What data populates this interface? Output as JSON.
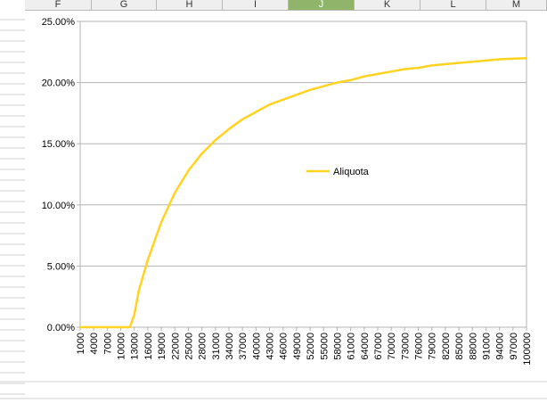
{
  "spreadsheet": {
    "columns": [
      "F",
      "G",
      "H",
      "I",
      "J",
      "K",
      "L",
      "M"
    ],
    "selected_column": "J",
    "accent_color": "#8fb46a"
  },
  "chart_data": {
    "type": "line",
    "title": "",
    "xlabel": "",
    "ylabel": "",
    "ylim": [
      0,
      0.25
    ],
    "yticks": [
      "0.00%",
      "5.00%",
      "10.00%",
      "15.00%",
      "20.00%",
      "25.00%"
    ],
    "grid": true,
    "legend_position": "center-right",
    "x_tick_labels": [
      "1000",
      "4000",
      "7000",
      "10000",
      "13000",
      "16000",
      "19000",
      "22000",
      "25000",
      "28000",
      "31000",
      "34000",
      "37000",
      "40000",
      "43000",
      "46000",
      "49000",
      "52000",
      "55000",
      "58000",
      "61000",
      "64000",
      "67000",
      "70000",
      "73000",
      "76000",
      "79000",
      "82000",
      "85000",
      "88000",
      "91000",
      "94000",
      "97000",
      "100000"
    ],
    "series": [
      {
        "name": "Aliquota",
        "color": "#ffd320",
        "x": [
          1000,
          4000,
          7000,
          10000,
          12000,
          13000,
          14000,
          16000,
          19000,
          22000,
          25000,
          28000,
          31000,
          34000,
          37000,
          40000,
          43000,
          46000,
          49000,
          52000,
          55000,
          58000,
          61000,
          64000,
          67000,
          70000,
          73000,
          76000,
          79000,
          82000,
          85000,
          88000,
          91000,
          94000,
          97000,
          100000
        ],
        "values": [
          0,
          0,
          0,
          0,
          0,
          0.01,
          0.03,
          0.055,
          0.086,
          0.11,
          0.128,
          0.142,
          0.153,
          0.162,
          0.17,
          0.176,
          0.182,
          0.186,
          0.19,
          0.194,
          0.197,
          0.2,
          0.202,
          0.205,
          0.207,
          0.209,
          0.211,
          0.212,
          0.214,
          0.215,
          0.216,
          0.217,
          0.218,
          0.219,
          0.2195,
          0.22
        ]
      }
    ]
  }
}
